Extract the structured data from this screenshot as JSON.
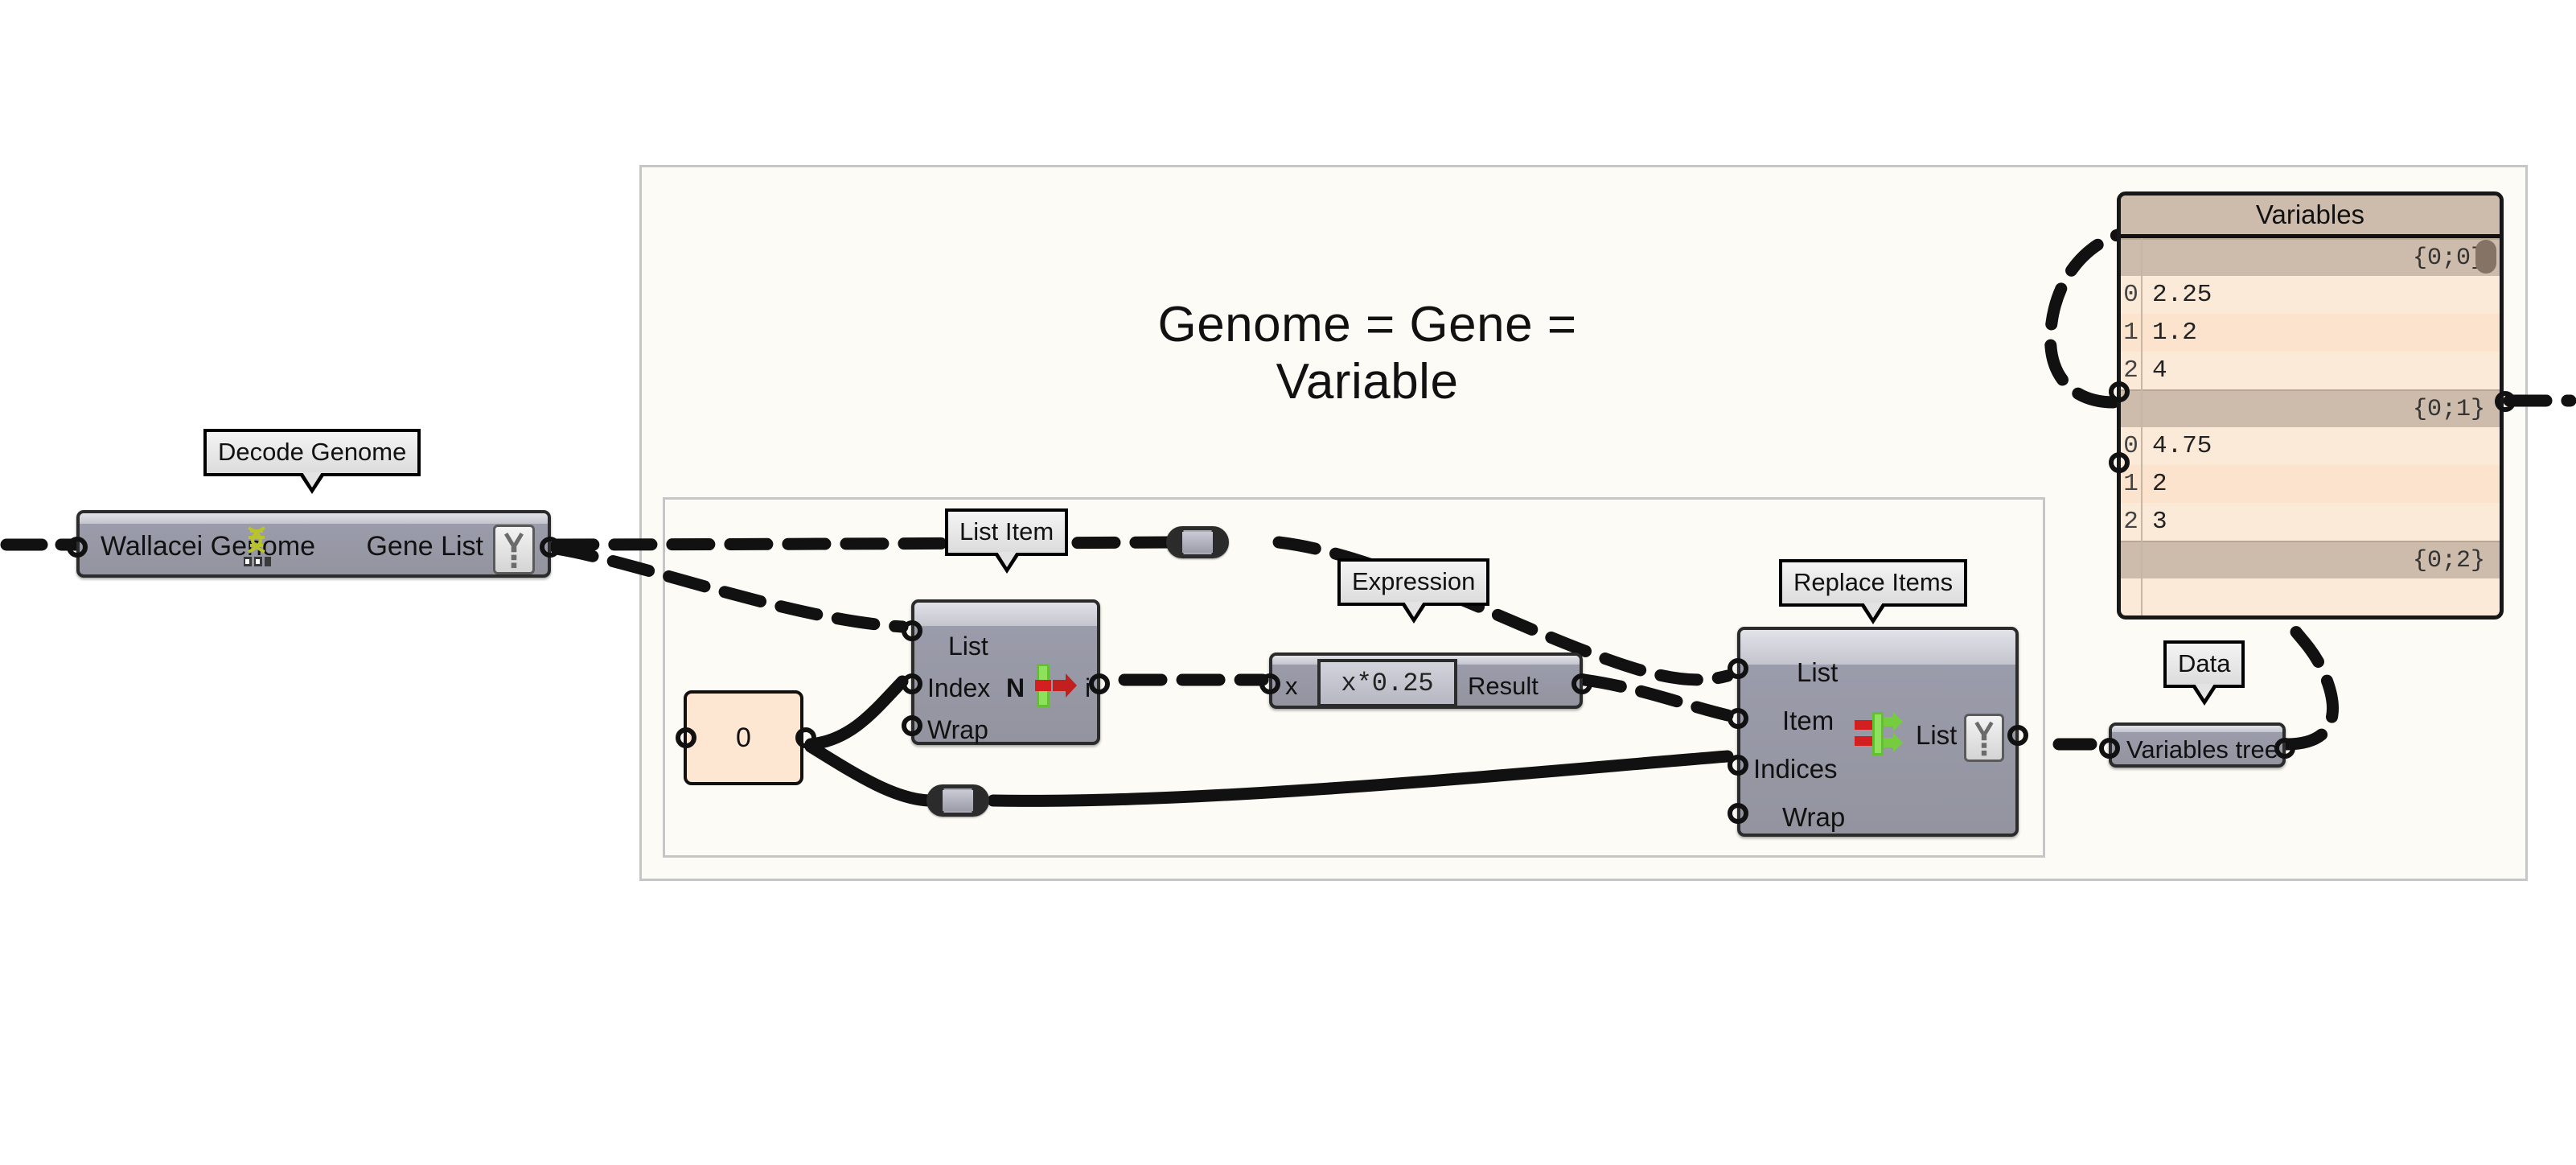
{
  "canvas": {
    "title": "Genome = Gene = Variable",
    "background": "#ffffff",
    "group_fill": "#fdfbf5",
    "group_border": "#c6c6c6",
    "component_fill": "#9b9cab",
    "panel_fill": "#fde6d2",
    "data_panel_fill": "#fcead8",
    "data_panel_header_fill": "#cdbcab"
  },
  "labels": {
    "decode_genome": "Decode Genome",
    "list_item": "List Item",
    "expression": "Expression",
    "replace_items": "Replace Items",
    "data": "Data"
  },
  "nodes": {
    "wallacei_genome": {
      "input_label": "Wallacei Genome",
      "output_label": "Gene List",
      "icon": "dna-icon",
      "output_flag": "zip-flatten-icon"
    },
    "list_item": {
      "inputs": [
        "List",
        "Index",
        "Wrap"
      ],
      "output": "i",
      "index_prefix": "N",
      "icon": "list-item-icon"
    },
    "number_panel": {
      "value": "0"
    },
    "expression": {
      "input": "x",
      "formula": "x*0.25",
      "output": "Result",
      "icon": "expression-icon"
    },
    "replace_items": {
      "inputs": [
        "List",
        "Item",
        "Indices",
        "Wrap"
      ],
      "output": "List",
      "icon": "replace-items-icon",
      "output_flag": "zip-flatten-icon"
    },
    "variables_tree": {
      "label": "Variables tree"
    }
  },
  "variables_panel": {
    "title": "Variables",
    "branches": [
      {
        "path": "{0;0}",
        "items": [
          {
            "index": "0",
            "value": "2.25"
          },
          {
            "index": "1",
            "value": "1.2"
          },
          {
            "index": "2",
            "value": "4"
          }
        ]
      },
      {
        "path": "{0;1}",
        "items": [
          {
            "index": "0",
            "value": "4.75"
          },
          {
            "index": "1",
            "value": "2"
          },
          {
            "index": "2",
            "value": "3"
          }
        ]
      },
      {
        "path": "{0;2}",
        "items": []
      }
    ]
  }
}
